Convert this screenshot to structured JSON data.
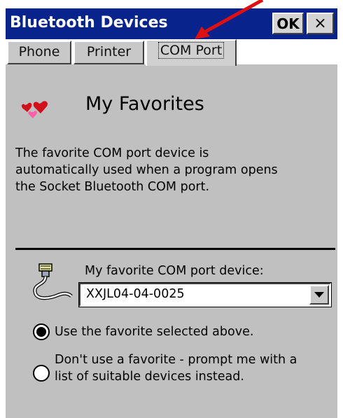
{
  "window": {
    "title": "Bluetooth Devices",
    "ok_label": "OK",
    "close_label": "×",
    "title_bar_color": "#08248c",
    "background_color": "#c0c0c0"
  },
  "tabs": [
    {
      "label": "Phone",
      "selected": false
    },
    {
      "label": "Printer",
      "selected": false
    },
    {
      "label": "COM Port",
      "selected": true
    }
  ],
  "content": {
    "icon": "hearts-icon",
    "heading": "My Favorites",
    "description_lines": [
      "The favorite COM port device is",
      "automatically used when a program opens",
      "the Socket Bluetooth COM port."
    ],
    "combo_icon": "serial-cable-icon",
    "combo_label": "My favorite COM port device:",
    "combo_value": "XXJL04-04-0025",
    "radio_options": [
      {
        "lines": [
          "Use the favorite selected above."
        ],
        "checked": true
      },
      {
        "lines": [
          "Don't use a favorite - prompt me with a",
          "list of suitable devices instead."
        ],
        "checked": false
      }
    ]
  },
  "annotation": {
    "arrow_color": "#e01010",
    "points_to": "COM Port tab"
  }
}
